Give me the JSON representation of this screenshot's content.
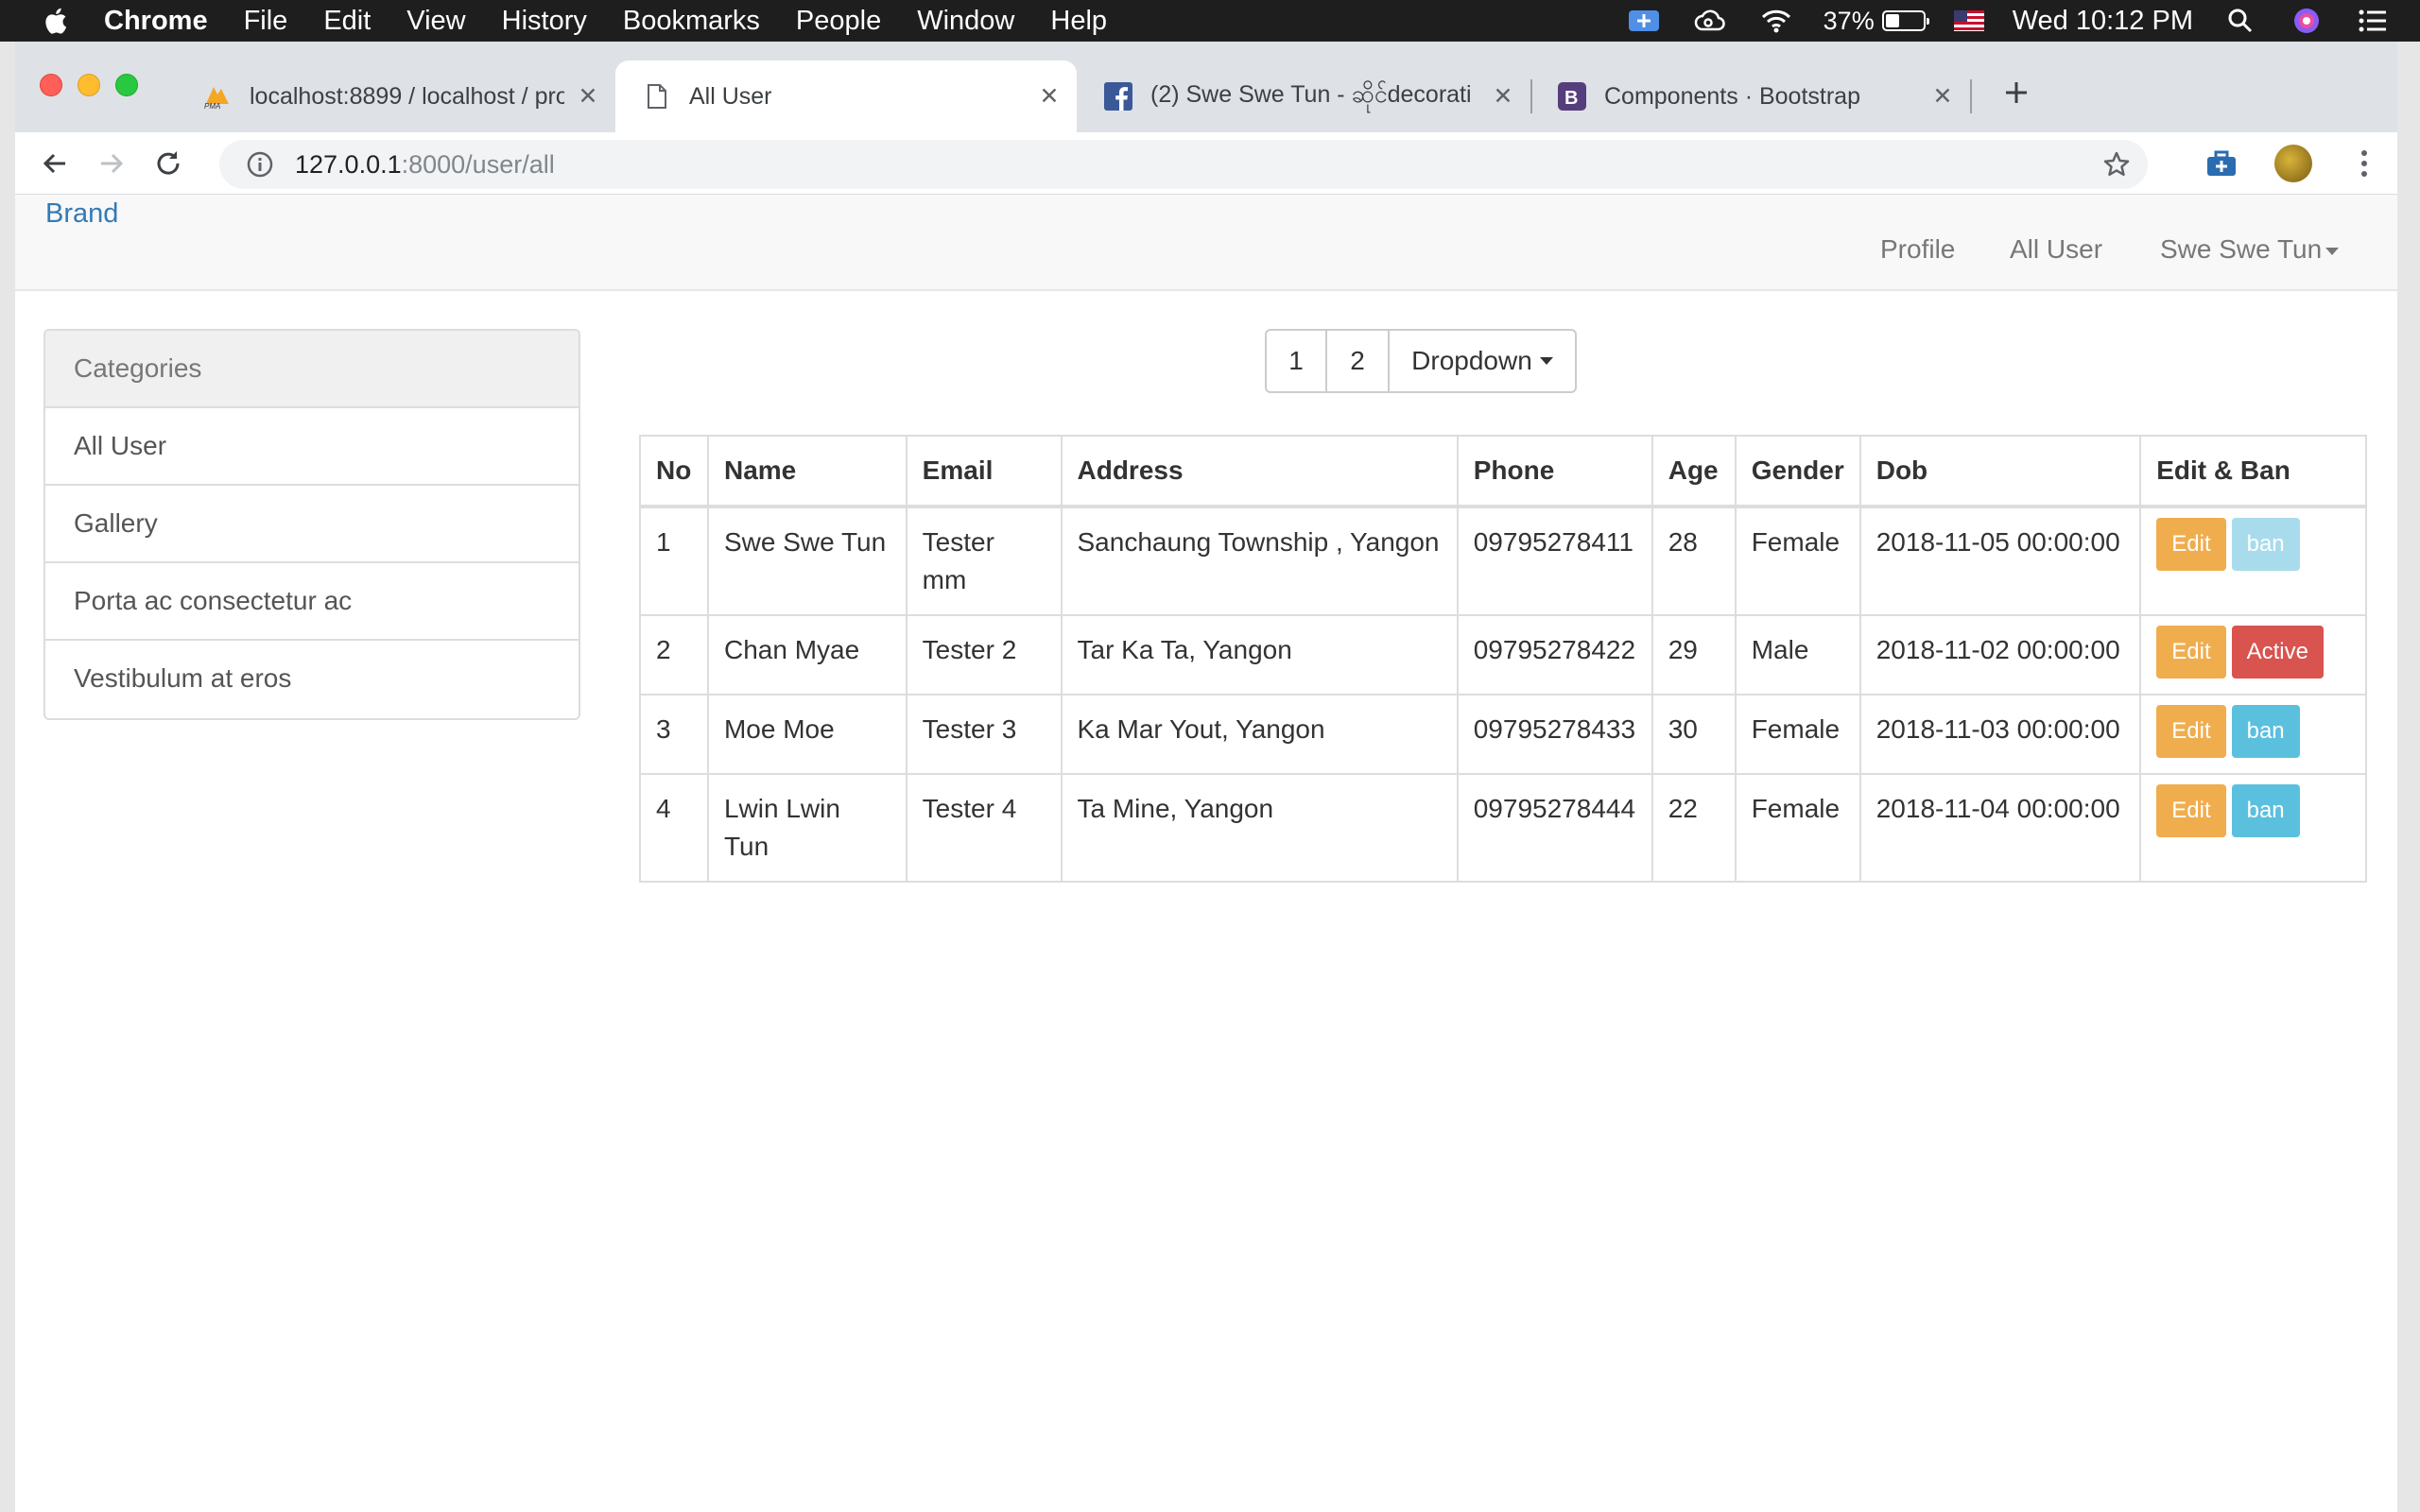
{
  "menubar": {
    "app_name": "Chrome",
    "items": [
      "File",
      "Edit",
      "View",
      "History",
      "Bookmarks",
      "People",
      "Window",
      "Help"
    ],
    "battery_percent": "37%",
    "battery_level": 0.37,
    "clock": "Wed 10:12 PM"
  },
  "tabs": [
    {
      "title": "localhost:8899 / localhost / pro",
      "icon": "pma-icon"
    },
    {
      "title": "All User",
      "icon": "page-icon"
    },
    {
      "title": "(2) Swe Swe Tun - ဆိုင်decorati",
      "icon": "facebook-icon"
    },
    {
      "title": "Components · Bootstrap",
      "icon": "bootstrap-icon"
    }
  ],
  "omnibox": {
    "host": "127.0.0.1",
    "path": ":8000/user/all"
  },
  "navbar": {
    "brand": "Brand",
    "links": {
      "profile": "Profile",
      "all_user": "All User",
      "user_menu": "Swe Swe Tun"
    }
  },
  "sidebar": {
    "heading": "Categories",
    "items": [
      "All User",
      "Gallery",
      "Porta ac consectetur ac",
      "Vestibulum at eros"
    ]
  },
  "pager": {
    "page1": "1",
    "page2": "2",
    "dropdown": "Dropdown"
  },
  "table": {
    "headers": {
      "no": "No",
      "name": "Name",
      "email": "Email",
      "address": "Address",
      "phone": "Phone",
      "age": "Age",
      "gender": "Gender",
      "dob": "Dob",
      "actions": "Edit & Ban"
    },
    "rows": [
      {
        "no": "1",
        "name": "Swe Swe Tun",
        "email": "Tester mm",
        "address": "Sanchaung Township , Yangon",
        "phone": "09795278411",
        "age": "28",
        "gender": "Female",
        "dob": "2018-11-05 00:00:00",
        "edit": "Edit",
        "status": "ban"
      },
      {
        "no": "2",
        "name": "Chan Myae",
        "email": "Tester 2",
        "address": "Tar Ka Ta, Yangon",
        "phone": "09795278422",
        "age": "29",
        "gender": "Male",
        "dob": "2018-11-02 00:00:00",
        "edit": "Edit",
        "status": "Active"
      },
      {
        "no": "3",
        "name": "Moe Moe",
        "email": "Tester 3",
        "address": "Ka Mar Yout, Yangon",
        "phone": "09795278433",
        "age": "30",
        "gender": "Female",
        "dob": "2018-11-03 00:00:00",
        "edit": "Edit",
        "status": "ban"
      },
      {
        "no": "4",
        "name": "Lwin Lwin Tun",
        "email": "Tester 4",
        "address": "Ta Mine, Yangon",
        "phone": "09795278444",
        "age": "22",
        "gender": "Female",
        "dob": "2018-11-04 00:00:00",
        "edit": "Edit",
        "status": "ban"
      }
    ]
  },
  "colors": {
    "link": "#337ab7",
    "edit": "#f0ad4e",
    "ban": "#5bc0de",
    "danger": "#d9534f"
  }
}
